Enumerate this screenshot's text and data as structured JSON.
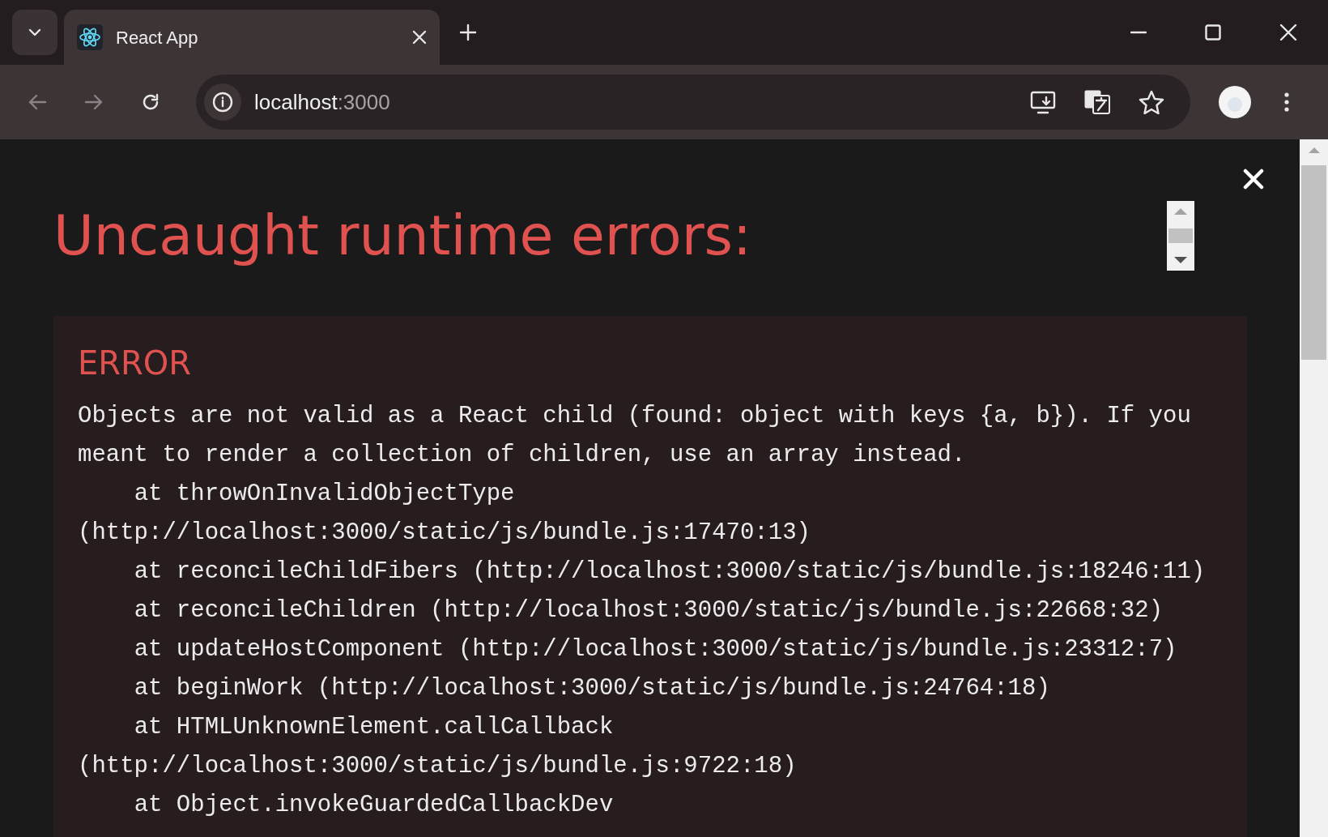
{
  "browser": {
    "tab": {
      "title": "React App"
    },
    "address": {
      "host": "localhost",
      "port": ":3000"
    }
  },
  "overlay": {
    "title": "Uncaught runtime errors:",
    "errors": [
      {
        "label": "ERROR",
        "message": "Objects are not valid as a React child (found: object with keys {a, b}). If you meant to render a collection of children, use an array instead.",
        "stack": [
          "at throwOnInvalidObjectType (http://localhost:3000/static/js/bundle.js:17470:13)",
          "at reconcileChildFibers (http://localhost:3000/static/js/bundle.js:18246:11)",
          "at reconcileChildren (http://localhost:3000/static/js/bundle.js:22668:32)",
          "at updateHostComponent (http://localhost:3000/static/js/bundle.js:23312:7)",
          "at beginWork (http://localhost:3000/static/js/bundle.js:24764:18)",
          "at HTMLUnknownElement.callCallback (http://localhost:3000/static/js/bundle.js:9722:18)",
          "at Object.invokeGuardedCallbackDev"
        ]
      }
    ]
  }
}
